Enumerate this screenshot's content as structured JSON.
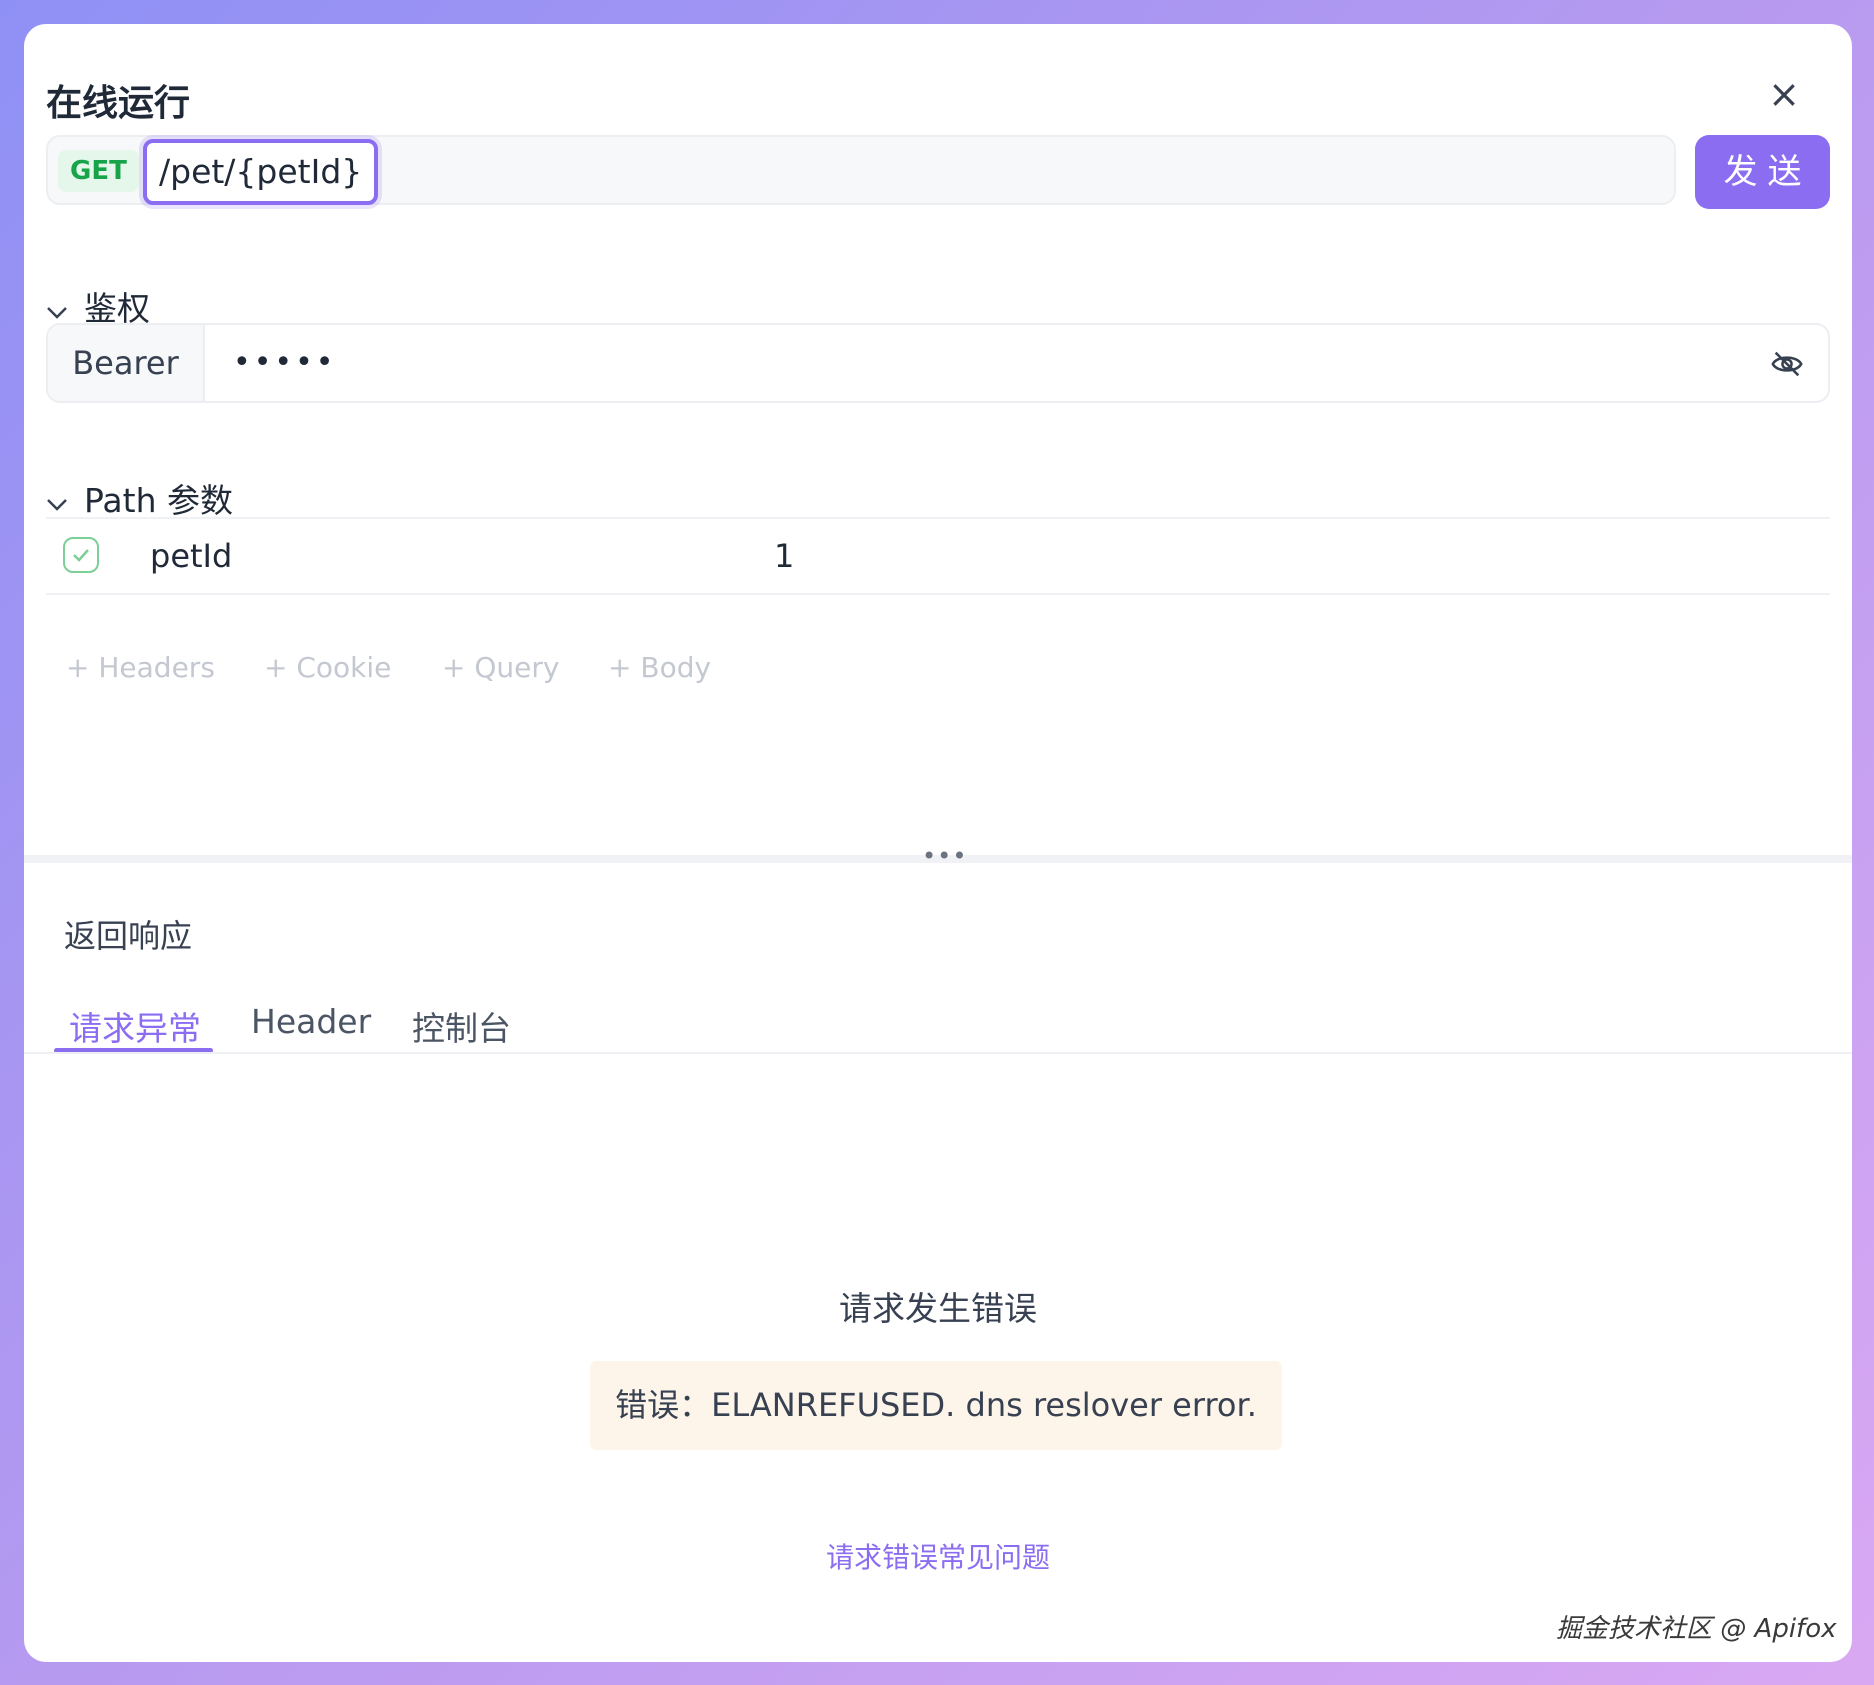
{
  "dialog": {
    "title": "在线运行",
    "close_label": "×"
  },
  "request": {
    "method": "GET",
    "path": "/pet/{petId}",
    "send_label": "发送"
  },
  "auth": {
    "section_label": "鉴权",
    "type": "Bearer",
    "masked_value": "•••••",
    "visibility_icon": "eye-off-icon"
  },
  "path_params": {
    "section_label": "Path 参数",
    "rows": [
      {
        "enabled": true,
        "name": "petId",
        "value": "1"
      }
    ]
  },
  "add_links": {
    "headers": "+ Headers",
    "cookie": "+ Cookie",
    "query": "+ Query",
    "body": "+ Body"
  },
  "resizer": {
    "dots": "•••"
  },
  "response": {
    "title": "返回响应",
    "tabs": [
      {
        "label": "请求异常",
        "active": true
      },
      {
        "label": "Header",
        "active": false
      },
      {
        "label": "控制台",
        "active": false
      }
    ],
    "error_title": "请求发生错误",
    "error_message": "错误：ELANREFUSED. dns reslover error.",
    "faq_link": "请求错误常见问题"
  },
  "watermark": "掘金技术社区 @ Apifox",
  "colors": {
    "accent": "#8b6df2",
    "get_method": "#17a34a",
    "get_bg": "#e4f7ea",
    "error_bg": "#fdf5ea",
    "check_green": "#7ccf95"
  }
}
